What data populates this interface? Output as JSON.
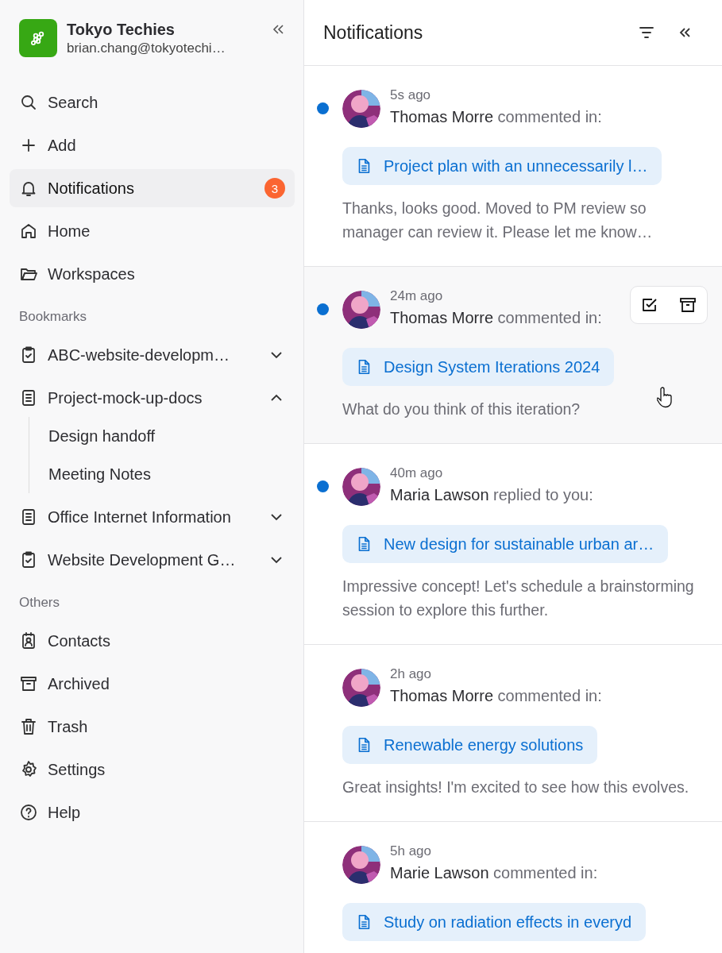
{
  "workspace": {
    "name": "Tokyo Techies",
    "email": "brian.chang@tokyotechi…"
  },
  "nav": [
    {
      "label": "Search",
      "selected": false
    },
    {
      "label": "Add",
      "selected": false
    },
    {
      "label": "Notifications",
      "selected": true,
      "badge": "3"
    },
    {
      "label": "Home",
      "selected": false
    },
    {
      "label": "Workspaces",
      "selected": false
    }
  ],
  "bookmarks": {
    "heading": "Bookmarks",
    "items": [
      {
        "label": "ABC-website-developm…",
        "kind": "checklist",
        "expanded": false
      },
      {
        "label": "Project-mock-up-docs",
        "kind": "document",
        "expanded": true,
        "children": [
          {
            "label": "Design handoff"
          },
          {
            "label": "Meeting Notes"
          }
        ]
      },
      {
        "label": "Office Internet Information",
        "kind": "document",
        "expanded": false
      },
      {
        "label": "Website Development G…",
        "kind": "checklist",
        "expanded": false
      }
    ]
  },
  "others": {
    "heading": "Others",
    "items": [
      {
        "label": "Contacts"
      },
      {
        "label": "Archived"
      },
      {
        "label": "Trash"
      },
      {
        "label": "Settings"
      },
      {
        "label": "Help"
      }
    ]
  },
  "panel": {
    "title": "Notifications"
  },
  "notifications": [
    {
      "time": "5s ago",
      "author": "Thomas Morre",
      "action": "commented in:",
      "document": "Project plan with an unnecessarily l…",
      "message": "Thanks, looks good. Moved to PM review so manager can review it. Please let me know…",
      "unread": true,
      "hovered": false
    },
    {
      "time": "24m ago",
      "author": "Thomas Morre",
      "action": "commented in:",
      "document": "Design System Iterations 2024",
      "message": "What do you think of this iteration?",
      "unread": true,
      "hovered": true
    },
    {
      "time": "40m ago",
      "author": "Maria Lawson",
      "action": "replied to you:",
      "document": "New design for sustainable urban ar…",
      "message": "Impressive concept! Let's schedule a brainstorming session to explore this further.",
      "unread": true,
      "hovered": false
    },
    {
      "time": "2h ago",
      "author": "Thomas Morre",
      "action": "commented in:",
      "document": "Renewable energy solutions",
      "message": "Great insights! I'm excited to see how this evolves.",
      "unread": false,
      "hovered": false
    },
    {
      "time": "5h ago",
      "author": "Marie Lawson",
      "action": "commented in:",
      "document": "Study on radiation effects in everyd",
      "unread": false,
      "hovered": false
    }
  ]
}
